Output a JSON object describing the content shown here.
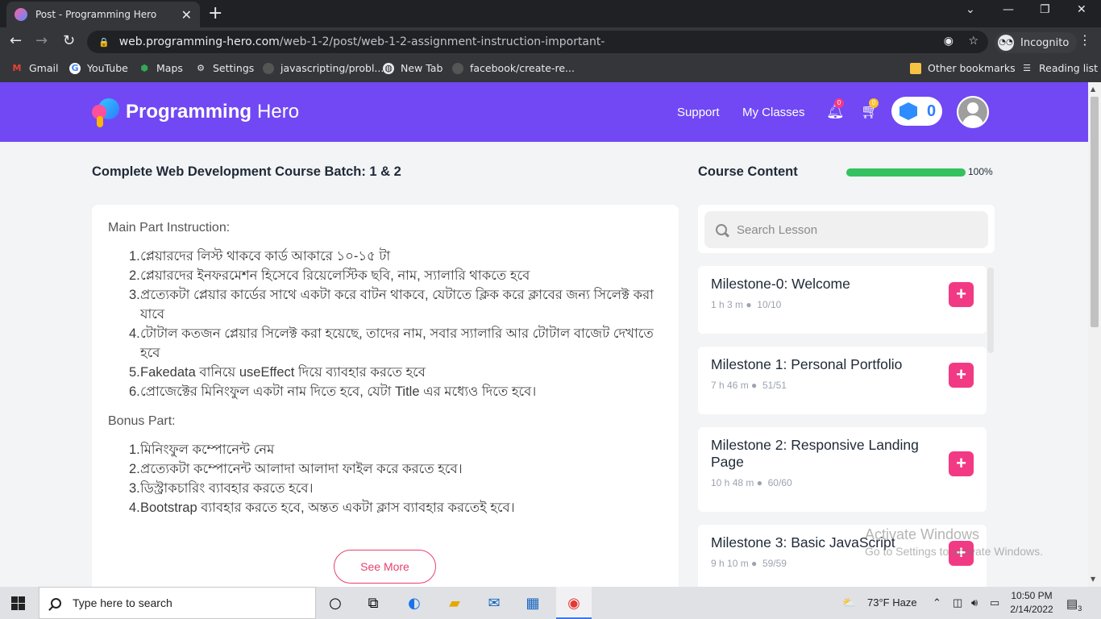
{
  "browser": {
    "tab_title": "Post - Programming Hero",
    "tab_close": "✕",
    "new_tab": "+",
    "window_controls": [
      "⌄",
      "—",
      "❐",
      "✕"
    ],
    "url_host": "web.programming-hero.com",
    "url_path": "/web-1-2/post/web-1-2-assignment-instruction-important-",
    "profile_label": "Incognito",
    "bookmarks": [
      "Gmail",
      "YouTube",
      "Maps",
      "Settings",
      "javascripting/probl...",
      "New Tab",
      "facebook/create-re...",
      "Other bookmarks",
      "Reading list"
    ]
  },
  "header": {
    "brand_bold": "Programming",
    "brand_light": "Hero",
    "nav": [
      "Support",
      "My Classes"
    ],
    "notif_count": "0",
    "cart_count": "0",
    "gems": "0"
  },
  "main": {
    "course_title": "Complete Web Development Course Batch: 1 & 2",
    "main_heading": "Main Part Instruction:",
    "main_items": [
      "প্লেয়ারদের লিস্ট থাকবে কার্ড আকারে ১০-১৫ টা",
      "প্লেয়ারদের ইনফরমেশন হিসেবে রিয়েলেস্টিক ছবি, নাম, স্যালারি থাকতে হবে",
      "প্রত্যেকটা প্লেয়ার কার্ডের সাথে একটা করে বাটন থাকবে, যেটাতে ক্লিক করে ক্লাবের জন্য সিলেক্ট করা যাবে",
      "টোটাল কতজন প্লেয়ার সিলেক্ট করা হয়েছে, তাদের নাম, সবার স্যালারি আর টোটাল বাজেট দেখাতে হবে",
      "Fakedata বানিয়ে useEffect দিয়ে ব্যাবহার করতে হবে",
      "প্রোজেক্টের মিনিংফুল একটা নাম দিতে হবে, যেটা Title এর মধ্যেও দিতে হবে।"
    ],
    "bonus_heading": "Bonus Part:",
    "bonus_items": [
      "মিনিংফুল কম্পোনেন্ট নেম",
      "প্রত্যেকটা কম্পোনেন্ট আলাদা আলাদা ফাইল করে করতে হবে।",
      "ডিস্ট্রাকচারিং ব্যাবহার করতে হবে।",
      "Bootstrap ব্যাবহার করতে হবে, অন্তত একটা ক্লাস ব্যাবহার করতেই হবে।"
    ],
    "see_more": "See More"
  },
  "sidebar": {
    "title": "Course Content",
    "progress_pct": 100,
    "progress_label": "100%",
    "search_placeholder": "Search Lesson",
    "milestones": [
      {
        "title": "Milestone-0: Welcome",
        "duration": "1 h 3 m",
        "count": "10/10"
      },
      {
        "title": "Milestone 1: Personal Portfolio",
        "duration": "7 h 46 m",
        "count": "51/51"
      },
      {
        "title": "Milestone 2: Responsive Landing Page",
        "duration": "10 h 48 m",
        "count": "60/60"
      },
      {
        "title": "Milestone 3: Basic JavaScript",
        "duration": "9 h 10 m",
        "count": "59/59"
      }
    ]
  },
  "watermark": {
    "line1": "Activate Windows",
    "line2": "Go to Settings to activate Windows."
  },
  "taskbar": {
    "search_placeholder": "Type here to search",
    "weather": "73°F  Haze",
    "time": "10:50 PM",
    "date": "2/14/2022",
    "notif_count": "3"
  }
}
